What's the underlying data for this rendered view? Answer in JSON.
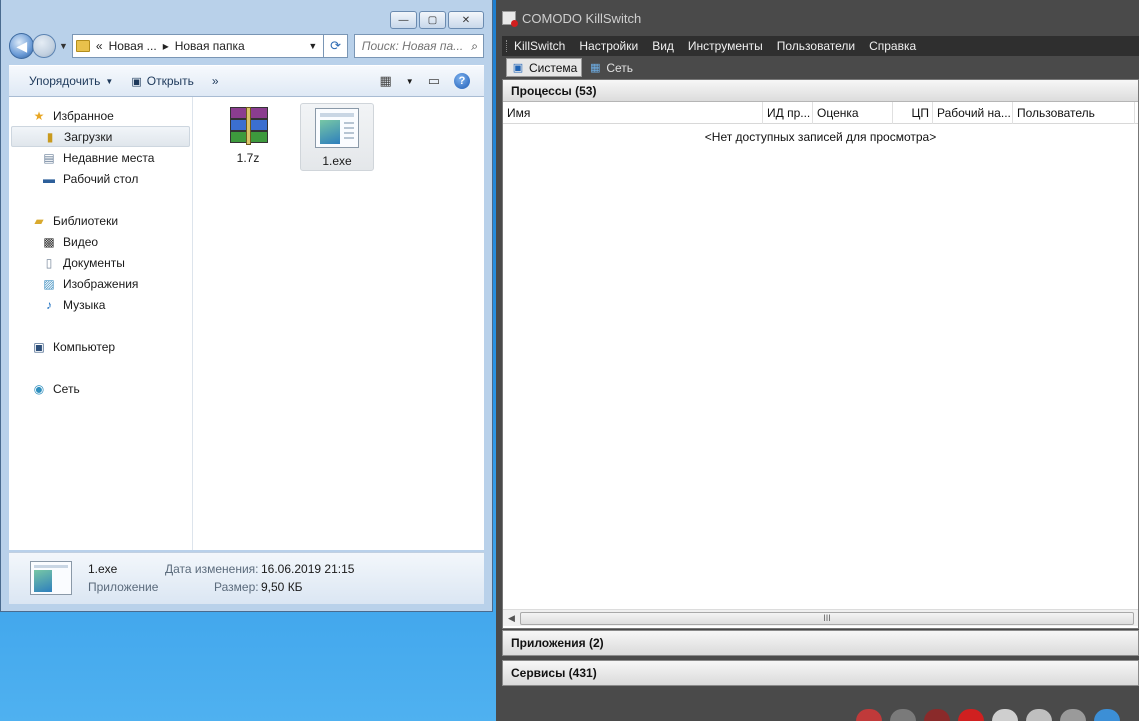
{
  "explorer": {
    "window_buttons": {
      "minimize": "—",
      "maximize": "▢",
      "close": "✕"
    },
    "address": {
      "overflow": "«",
      "crumb1": "Новая ...",
      "sep": "▸",
      "crumb2": "Новая папка"
    },
    "search": {
      "placeholder": "Поиск: Новая па..."
    },
    "toolbar": {
      "organize": "Упорядочить",
      "open": "Открыть",
      "more": "»"
    },
    "sidebar": {
      "favorites": {
        "label": "Избранное",
        "items": [
          "Загрузки",
          "Недавние места",
          "Рабочий стол"
        ]
      },
      "libraries": {
        "label": "Библиотеки",
        "items": [
          "Видео",
          "Документы",
          "Изображения",
          "Музыка"
        ]
      },
      "computer": "Компьютер",
      "network": "Сеть"
    },
    "files": [
      {
        "name": "1.7z",
        "icon": "winrar-archive-icon"
      },
      {
        "name": "1.exe",
        "icon": "exe-app-icon",
        "selected": true
      }
    ],
    "status": {
      "name": "1.exe",
      "type": "Приложение",
      "modified_label": "Дата изменения:",
      "modified_value": "16.06.2019 21:15",
      "size_label": "Размер:",
      "size_value": "9,50 КБ"
    }
  },
  "killswitch": {
    "title": "COMODO KillSwitch",
    "menu": [
      "KillSwitch",
      "Настройки",
      "Вид",
      "Инструменты",
      "Пользователи",
      "Справка"
    ],
    "tabs": [
      "Система",
      "Сеть"
    ],
    "processes_header": "Процессы (53)",
    "columns": [
      "Имя",
      "ИД пр...",
      "Оценка",
      "ЦП",
      "Рабочий на...",
      "Пользователь"
    ],
    "empty_message": "<Нет доступных записей для просмотра>",
    "scroll_grip": "III",
    "applications_header": "Приложения (2)",
    "services_header": "Сервисы (431)"
  },
  "colors": {
    "desktop": "#2a95e6",
    "ks_dark": "#4a4a4a",
    "explorer_frame": "#b9d1ea"
  }
}
